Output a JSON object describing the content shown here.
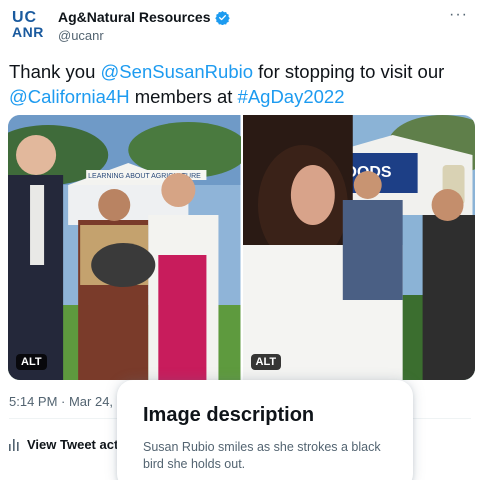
{
  "logo": {
    "line1": "UC",
    "line2": "ANR"
  },
  "account": {
    "display_name": "Ag&Natural Resources",
    "handle": "@ucanr",
    "verified_icon": "verified-badge-icon",
    "more_icon": "more-options-icon"
  },
  "tweet": {
    "parts": [
      {
        "text": "Thank you ",
        "mention": false
      },
      {
        "text": "@SenSusanRubio",
        "mention": true
      },
      {
        "text": " for stopping to visit our ",
        "mention": false
      },
      {
        "text": "@California4H",
        "mention": true
      },
      {
        "text": " members at ",
        "mention": false
      },
      {
        "text": "#AgDay2022",
        "mention": true
      }
    ]
  },
  "media": {
    "photos": [
      {
        "alt_label": "ALT",
        "banner": "LEARNING ABOUT AGRICULTURE"
      },
      {
        "alt_label": "ALT",
        "banner": "FOODS"
      }
    ]
  },
  "meta": {
    "timestamp": "5:14 PM · Mar 24, 2",
    "activity_label": "View Tweet acti",
    "activity_icon": "analytics-bars-icon"
  },
  "image_description": {
    "title": "Image description",
    "body": "Susan Rubio smiles as she strokes a black bird she holds out."
  },
  "colors": {
    "brand_blue": "#1a5a9e",
    "link_blue": "#1d9bf0",
    "secondary_text": "#536471"
  }
}
